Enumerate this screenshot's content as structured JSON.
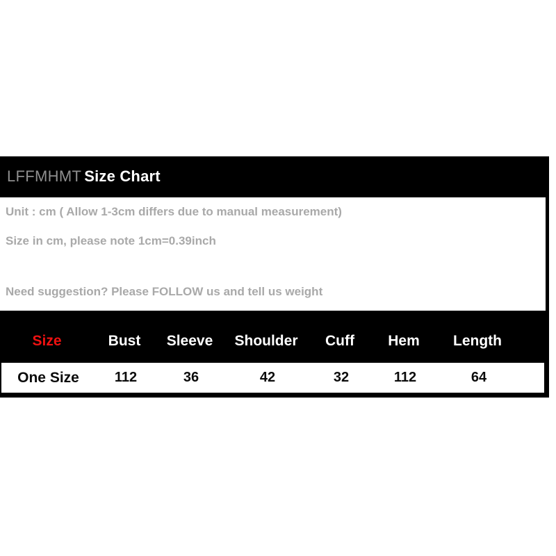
{
  "header": {
    "brand": "LFFMHMT",
    "title": "Size Chart"
  },
  "info": {
    "line1": "Unit : cm ( Allow 1-3cm differs due to manual measurement)",
    "line2": "Size in cm, please note 1cm=0.39inch",
    "line3": "Need suggestion? Please FOLLOW us and tell us weight"
  },
  "colors": {
    "panel_background": "#000000",
    "info_background": "#ffffff",
    "info_text": "#a9a9a9",
    "brand_text": "#8f8f8f",
    "title_text": "#ffffff",
    "header_text": "#ffffff",
    "size_accent": "#ee1111",
    "data_text": "#0b0b0b"
  },
  "chart_data": {
    "type": "table",
    "title": "Size Chart",
    "columns": [
      "Size",
      "Bust",
      "Sleeve",
      "Shoulder",
      "Cuff",
      "Hem",
      "Length"
    ],
    "rows": [
      {
        "size": "One Size",
        "bust": "112",
        "sleeve": "36",
        "shoulder": "42",
        "cuff": "32",
        "hem": "112",
        "length": "64"
      }
    ],
    "unit": "cm"
  }
}
